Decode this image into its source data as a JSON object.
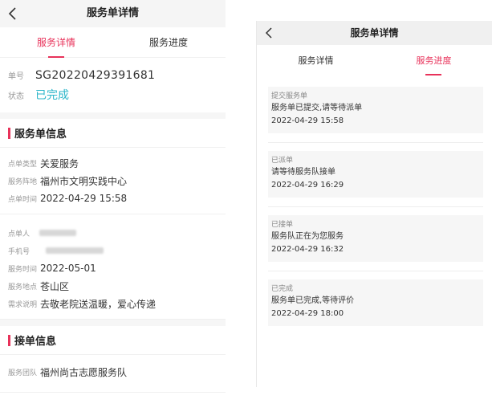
{
  "left": {
    "header": {
      "title": "服务单详情"
    },
    "tabs": [
      {
        "label": "服务详情"
      },
      {
        "label": "服务进度"
      }
    ],
    "order": {
      "no_label": "单号",
      "no_value": "SG20220429391681",
      "status_label": "状态",
      "status_value": "已完成"
    },
    "service_section": {
      "title": "服务单信息",
      "group1": [
        {
          "k": "点单类型",
          "v": "关爱服务"
        },
        {
          "k": "服务阵地",
          "v": "福州市文明实践中心"
        },
        {
          "k": "点单时间",
          "v": "2022-04-29 15:58"
        }
      ],
      "group2": [
        {
          "k": "点单人",
          "v": ""
        },
        {
          "k": "手机号",
          "v": ""
        },
        {
          "k": "服务时间",
          "v": "2022-05-01"
        },
        {
          "k": "服务地点",
          "v": "苍山区"
        },
        {
          "k": "需求说明",
          "v": "去敬老院送温暖，爱心传递"
        }
      ]
    },
    "accept_section": {
      "title": "接单信息",
      "rows": [
        {
          "k": "服务团队",
          "v": "福州尚古志愿服务队"
        }
      ]
    }
  },
  "right": {
    "header": {
      "title": "服务单详情"
    },
    "tabs": [
      {
        "label": "服务详情"
      },
      {
        "label": "服务进度"
      }
    ],
    "timeline": [
      {
        "status": "提交服务单",
        "msg": "服务单已提交,请等待派单",
        "time": "2022-04-29 15:58"
      },
      {
        "status": "已派单",
        "msg": "请等待服务队接单",
        "time": "2022-04-29 16:29"
      },
      {
        "status": "已接单",
        "msg": "服务队正在为您服务",
        "time": "2022-04-29 16:32"
      },
      {
        "status": "已完成",
        "msg": "服务单已完成,等待评价",
        "time": "2022-04-29 18:00"
      }
    ]
  },
  "icons": {
    "back": "chevron-left-icon"
  },
  "colors": {
    "accent": "#e8325a",
    "status_done": "#2bb6c9"
  }
}
